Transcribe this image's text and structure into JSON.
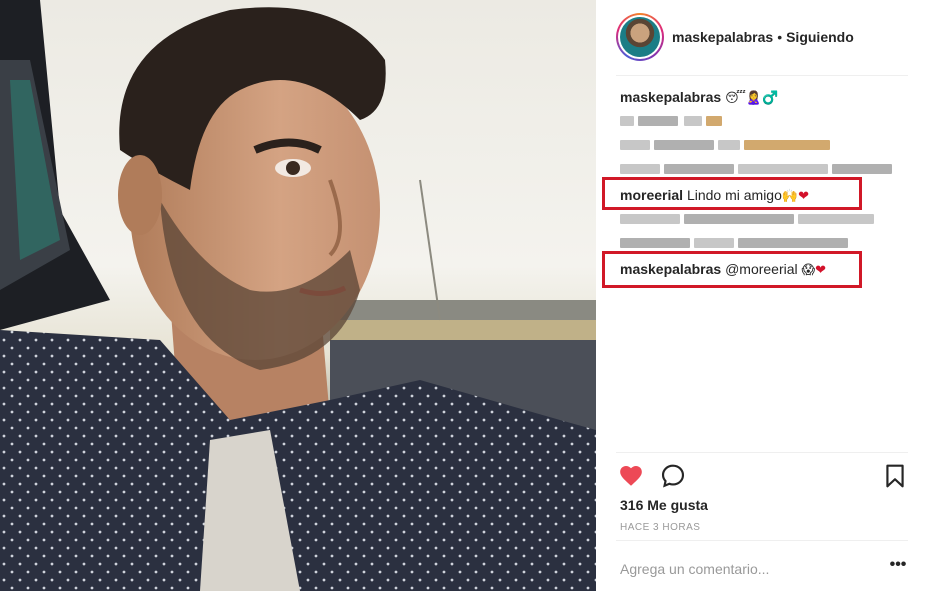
{
  "post": {
    "username": "maskepalabras",
    "separator": "•",
    "follow_status": "Siguiendo"
  },
  "caption": {
    "username": "maskepalabras",
    "emojis": "😴🙎‍♀️♂️"
  },
  "comments": [
    {
      "username": "moreerial",
      "text": "Lindo mi amigo",
      "emojis": "🙌",
      "heart": "❤"
    },
    {
      "username": "maskepalabras",
      "text": "@moreerial",
      "emojis": "😱",
      "heart": "❤"
    }
  ],
  "likes_text": "316 Me gusta",
  "time_ago": "HACE 3 HORAS",
  "add_comment_placeholder": "Agrega un comentario...",
  "more_options": "•••",
  "icons": {
    "like": "heart-icon",
    "comment": "comment-icon",
    "save": "bookmark-icon",
    "more": "more-options-icon"
  },
  "colors": {
    "like_heart": "#ed4956",
    "highlight_box": "#d11827",
    "story_ring": "#dd2a7b"
  }
}
